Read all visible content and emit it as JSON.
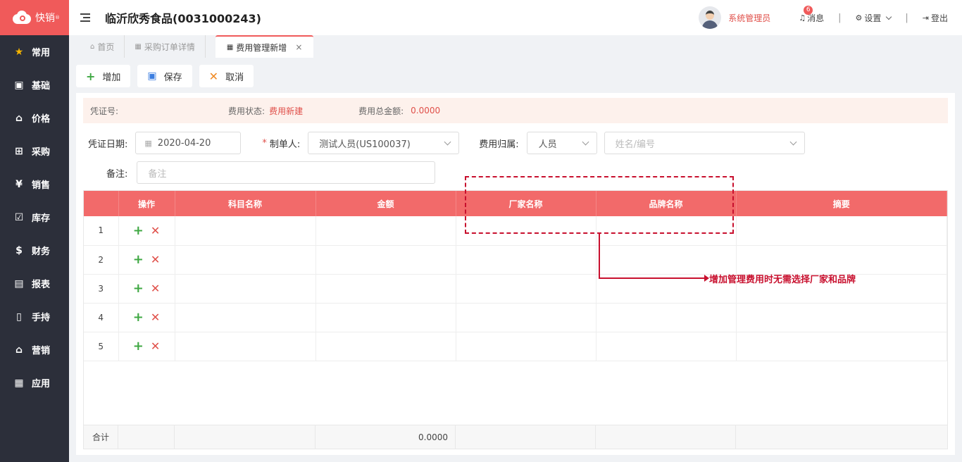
{
  "app": {
    "logo_text": "快销",
    "logo_sup": "®"
  },
  "sidebar": {
    "items": [
      {
        "label": "常用",
        "icon": "star-icon"
      },
      {
        "label": "基础",
        "icon": "grid-icon"
      },
      {
        "label": "价格",
        "icon": "tag-icon"
      },
      {
        "label": "采购",
        "icon": "cart-icon"
      },
      {
        "label": "销售",
        "icon": "yen-icon"
      },
      {
        "label": "库存",
        "icon": "checkbox-icon"
      },
      {
        "label": "财务",
        "icon": "moneybag-icon"
      },
      {
        "label": "报表",
        "icon": "report-icon"
      },
      {
        "label": "手持",
        "icon": "handheld-icon"
      },
      {
        "label": "营销",
        "icon": "store-icon"
      },
      {
        "label": "应用",
        "icon": "apps-icon"
      }
    ]
  },
  "header": {
    "title": "临沂欣秀食品(0031000243)",
    "user": "系统管理员",
    "messages_label": "消息",
    "messages_count": "6",
    "settings_label": "设置",
    "logout_label": "登出"
  },
  "tabs": [
    {
      "label": "首页"
    },
    {
      "label": "采购订单详情"
    },
    {
      "label": "费用管理新增",
      "close": "×"
    }
  ],
  "toolbar": {
    "add": "增加",
    "save": "保存",
    "cancel": "取消"
  },
  "info": {
    "voucher_no_label": "凭证号:",
    "status_label": "费用状态:",
    "status_value": "费用新建",
    "total_label": "费用总金额:",
    "total_value": "0.0000"
  },
  "form": {
    "date_label": "凭证日期:",
    "date_value": "2020-04-20",
    "maker_label": "制单人:",
    "maker_value": "测试人员(US100037)",
    "belong_label": "费用归属:",
    "belong_value": "人员",
    "person_placeholder": "姓名/编号",
    "remark_label": "备注:",
    "remark_placeholder": "备注"
  },
  "table": {
    "columns": [
      "",
      "操作",
      "科目名称",
      "金额",
      "厂家名称",
      "品牌名称",
      "摘要"
    ],
    "rows": [
      "1",
      "2",
      "3",
      "4",
      "5"
    ],
    "footer_label": "合计",
    "footer_amount": "0.0000"
  },
  "annotation": {
    "text": "增加管理费用时无需选择厂家和品牌"
  }
}
